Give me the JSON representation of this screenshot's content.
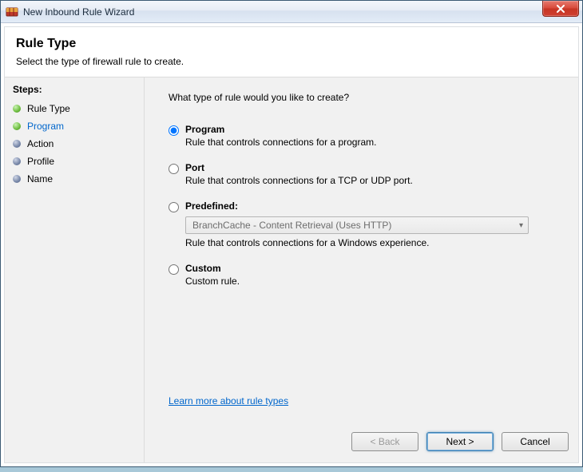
{
  "window": {
    "title": "New Inbound Rule Wizard",
    "close_label": "X"
  },
  "header": {
    "title": "Rule Type",
    "subtitle": "Select the type of firewall rule to create."
  },
  "steps": {
    "title": "Steps:",
    "items": [
      {
        "label": "Rule Type",
        "state": "done"
      },
      {
        "label": "Program",
        "state": "current"
      },
      {
        "label": "Action",
        "state": "pending"
      },
      {
        "label": "Profile",
        "state": "pending"
      },
      {
        "label": "Name",
        "state": "pending"
      }
    ]
  },
  "main": {
    "prompt": "What type of rule would you like to create?",
    "options": {
      "program": {
        "title": "Program",
        "desc": "Rule that controls connections for a program.",
        "selected": true
      },
      "port": {
        "title": "Port",
        "desc": "Rule that controls connections for a TCP or UDP port.",
        "selected": false
      },
      "predefined": {
        "title": "Predefined:",
        "dropdown_value": "BranchCache - Content Retrieval (Uses HTTP)",
        "desc": "Rule that controls connections for a Windows experience.",
        "selected": false
      },
      "custom": {
        "title": "Custom",
        "desc": "Custom rule.",
        "selected": false
      }
    },
    "learn_more": "Learn more about rule types"
  },
  "buttons": {
    "back": "< Back",
    "next": "Next >",
    "cancel": "Cancel"
  }
}
